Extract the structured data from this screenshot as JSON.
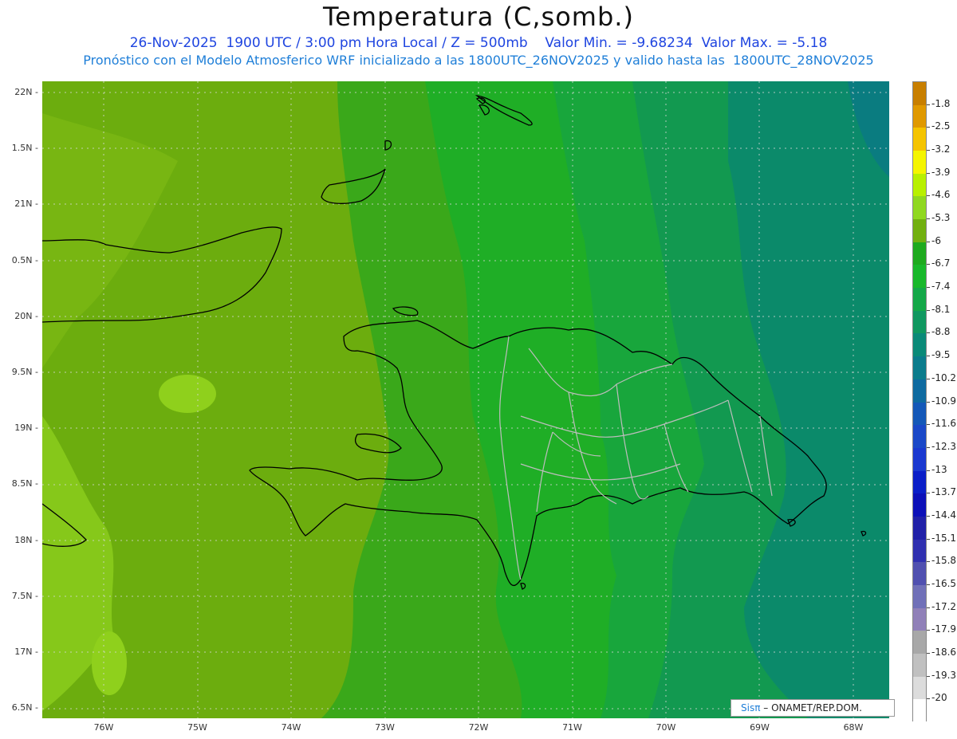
{
  "title": "Temperatura (C,somb.)",
  "subtitle1": "26-Nov-2025  1900 UTC / 3:00 pm Hora Local / Z = 500mb    Valor Min. = -9.68234  Valor Max. = -5.18",
  "subtitle2": "Pronóstico con el Modelo Atmosferico WRF inicializado a las 1800UTC_26NOV2025 y valido hasta las  1800UTC_28NOV2025",
  "credit": {
    "logo": "Sisπ",
    "text": " –  ONAMET/REP.DOM."
  },
  "axes": {
    "y_ticks": [
      "22N",
      "1.5N",
      "21N",
      "0.5N",
      "20N",
      "9.5N",
      "19N",
      "8.5N",
      "18N",
      "7.5N",
      "17N",
      "6.5N"
    ],
    "x_ticks": [
      "76W",
      "75W",
      "74W",
      "73W",
      "72W",
      "71W",
      "70W",
      "69W",
      "68W"
    ],
    "lat_range": [
      16.5,
      22.1
    ],
    "lon_range": [
      -76.65,
      -67.6
    ],
    "grid": "dotted"
  },
  "legend": {
    "labels": [
      "-1.8",
      "-2.5",
      "-3.2",
      "-3.9",
      "-4.6",
      "-5.3",
      "-6",
      "-6.7",
      "-7.4",
      "-8.1",
      "-8.8",
      "-9.5",
      "-10.2",
      "-10.9",
      "-11.6",
      "-12.3",
      "-13",
      "-13.7",
      "-14.4",
      "-15.1",
      "-15.8",
      "-16.5",
      "-17.2",
      "-17.9",
      "-18.6",
      "-19.3",
      "-20"
    ],
    "colors": [
      "#c87f00",
      "#e09900",
      "#f5c400",
      "#f5f500",
      "#b8f000",
      "#90d820",
      "#72b010",
      "#1eaa1e",
      "#18b82a",
      "#14a848",
      "#109860",
      "#0a8a78",
      "#0b7c8c",
      "#0e6aa0",
      "#1458b8",
      "#1a48c8",
      "#1a38d0",
      "#0a1ec8",
      "#0c10b8",
      "#2020a8",
      "#3030b0",
      "#5050b0",
      "#7070b8",
      "#9080b8",
      "#a8a8a8",
      "#c0c0c0",
      "#dcdcdc",
      "#ffffff"
    ]
  },
  "map": {
    "variable": "Temperatura 500mb",
    "min": -9.68234,
    "max": -5.18
  }
}
